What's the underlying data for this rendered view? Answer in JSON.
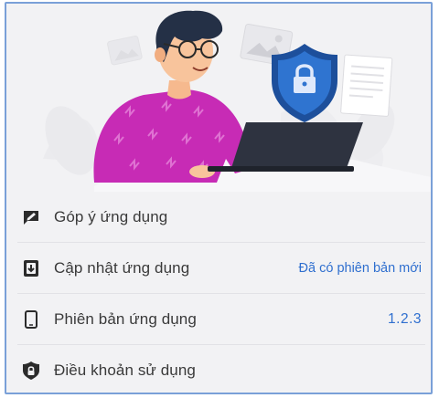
{
  "menu": {
    "items": [
      {
        "label": "Góp ý ứng dụng",
        "icon": "feedback-icon",
        "value": ""
      },
      {
        "label": "Cập nhật ứng dụng",
        "icon": "update-icon",
        "value": "Đã có phiên bản mới"
      },
      {
        "label": "Phiên bản ứng dụng",
        "icon": "phone-icon",
        "value": "1.2.3"
      },
      {
        "label": "Điều khoản sử dụng",
        "icon": "shield-lock-icon",
        "value": ""
      }
    ]
  },
  "colors": {
    "accent": "#2f6fcf",
    "sweater": "#c72bb5",
    "shield": "#2a6bc4",
    "background": "#f2f2f4"
  }
}
